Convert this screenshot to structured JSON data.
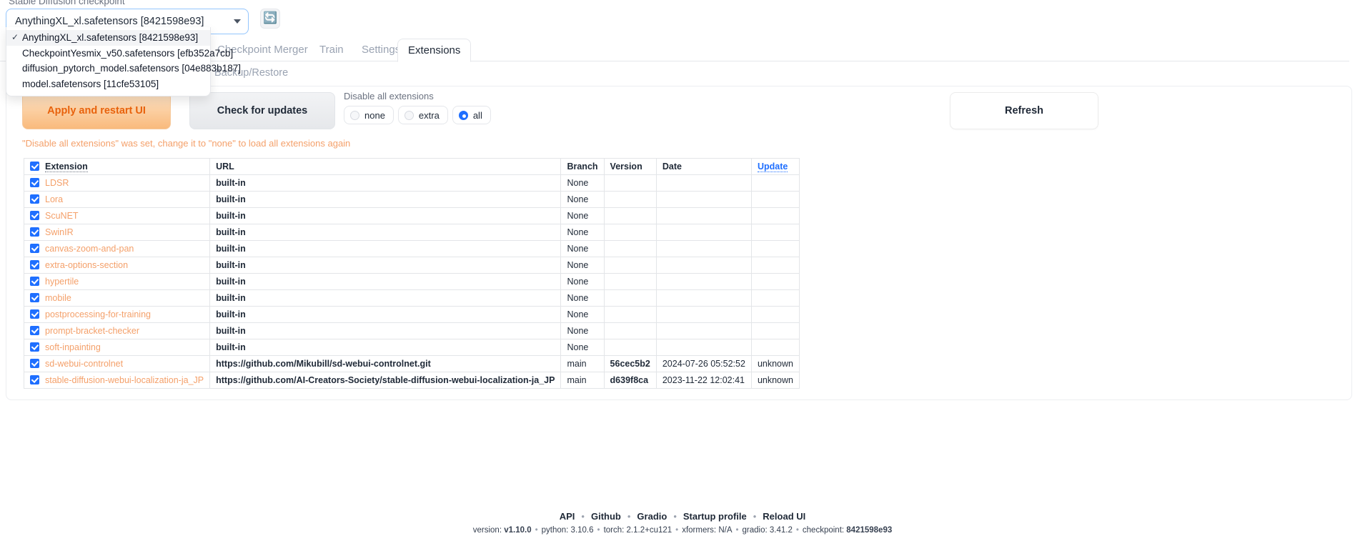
{
  "checkpoint": {
    "label": "Stable Diffusion checkpoint",
    "value": "AnythingXL_xl.safetensors [8421598e93]",
    "refresh_icon": "refresh-icon",
    "options": [
      "AnythingXL_xl.safetensors [8421598e93]",
      "CheckpointYesmix_v50.safetensors [efb352a7cb]",
      "diffusion_pytorch_model.safetensors [04e883b187]",
      "model.safetensors [11cfe53105]"
    ],
    "selected_index": 0,
    "check_glyph": "✓"
  },
  "tabs": [
    {
      "label": "Checkpoint Merger",
      "active": false
    },
    {
      "label": "Train",
      "active": false
    },
    {
      "label": "Settings",
      "active": false
    },
    {
      "label": "Extensions",
      "active": true
    }
  ],
  "subtabs": [
    {
      "label": "Backup/Restore"
    }
  ],
  "actions": {
    "apply_label": "Apply and restart UI",
    "check_updates_label": "Check for updates",
    "refresh_label": "Refresh"
  },
  "disable_all": {
    "title": "Disable all extensions",
    "options": [
      "none",
      "extra",
      "all"
    ],
    "selected": "all"
  },
  "warning": "\"Disable all extensions\" was set, change it to \"none\" to load all extensions again",
  "table": {
    "headers": {
      "extension": "Extension",
      "url": "URL",
      "branch": "Branch",
      "version": "Version",
      "date": "Date",
      "update": "Update"
    },
    "rows": [
      {
        "name": "LDSR",
        "url": "built-in",
        "branch": "None",
        "version": "",
        "date": "",
        "update": "",
        "checked": true
      },
      {
        "name": "Lora",
        "url": "built-in",
        "branch": "None",
        "version": "",
        "date": "",
        "update": "",
        "checked": true
      },
      {
        "name": "ScuNET",
        "url": "built-in",
        "branch": "None",
        "version": "",
        "date": "",
        "update": "",
        "checked": true
      },
      {
        "name": "SwinIR",
        "url": "built-in",
        "branch": "None",
        "version": "",
        "date": "",
        "update": "",
        "checked": true
      },
      {
        "name": "canvas-zoom-and-pan",
        "url": "built-in",
        "branch": "None",
        "version": "",
        "date": "",
        "update": "",
        "checked": true
      },
      {
        "name": "extra-options-section",
        "url": "built-in",
        "branch": "None",
        "version": "",
        "date": "",
        "update": "",
        "checked": true
      },
      {
        "name": "hypertile",
        "url": "built-in",
        "branch": "None",
        "version": "",
        "date": "",
        "update": "",
        "checked": true
      },
      {
        "name": "mobile",
        "url": "built-in",
        "branch": "None",
        "version": "",
        "date": "",
        "update": "",
        "checked": true
      },
      {
        "name": "postprocessing-for-training",
        "url": "built-in",
        "branch": "None",
        "version": "",
        "date": "",
        "update": "",
        "checked": true
      },
      {
        "name": "prompt-bracket-checker",
        "url": "built-in",
        "branch": "None",
        "version": "",
        "date": "",
        "update": "",
        "checked": true
      },
      {
        "name": "soft-inpainting",
        "url": "built-in",
        "branch": "None",
        "version": "",
        "date": "",
        "update": "",
        "checked": true
      },
      {
        "name": "sd-webui-controlnet",
        "url": "https://github.com/Mikubill/sd-webui-controlnet.git",
        "branch": "main",
        "version": "56cec5b2",
        "date": "2024-07-26 05:52:52",
        "update": "unknown",
        "checked": true
      },
      {
        "name": "stable-diffusion-webui-localization-ja_JP",
        "url": "https://github.com/AI-Creators-Society/stable-diffusion-webui-localization-ja_JP",
        "branch": "main",
        "version": "d639f8ca",
        "date": "2023-11-22 12:02:41",
        "update": "unknown",
        "checked": true
      }
    ]
  },
  "footer": {
    "links": [
      "API",
      "Github",
      "Gradio",
      "Startup profile",
      "Reload UI"
    ],
    "separator": "•",
    "meta": [
      {
        "key": "version:",
        "value": "v1.10.0",
        "bold": true
      },
      {
        "key": "python:",
        "value": "3.10.6",
        "bold": false
      },
      {
        "key": "torch:",
        "value": "2.1.2+cu121",
        "bold": false
      },
      {
        "key": "xformers:",
        "value": "N/A",
        "bold": false
      },
      {
        "key": "gradio:",
        "value": "3.41.2",
        "bold": false
      },
      {
        "key": "checkpoint:",
        "value": "8421598e93",
        "bold": true
      }
    ]
  },
  "colors": {
    "accent_orange": "#f4a06a",
    "accent_blue": "#1f6fff",
    "apply_text": "#e8620c"
  }
}
